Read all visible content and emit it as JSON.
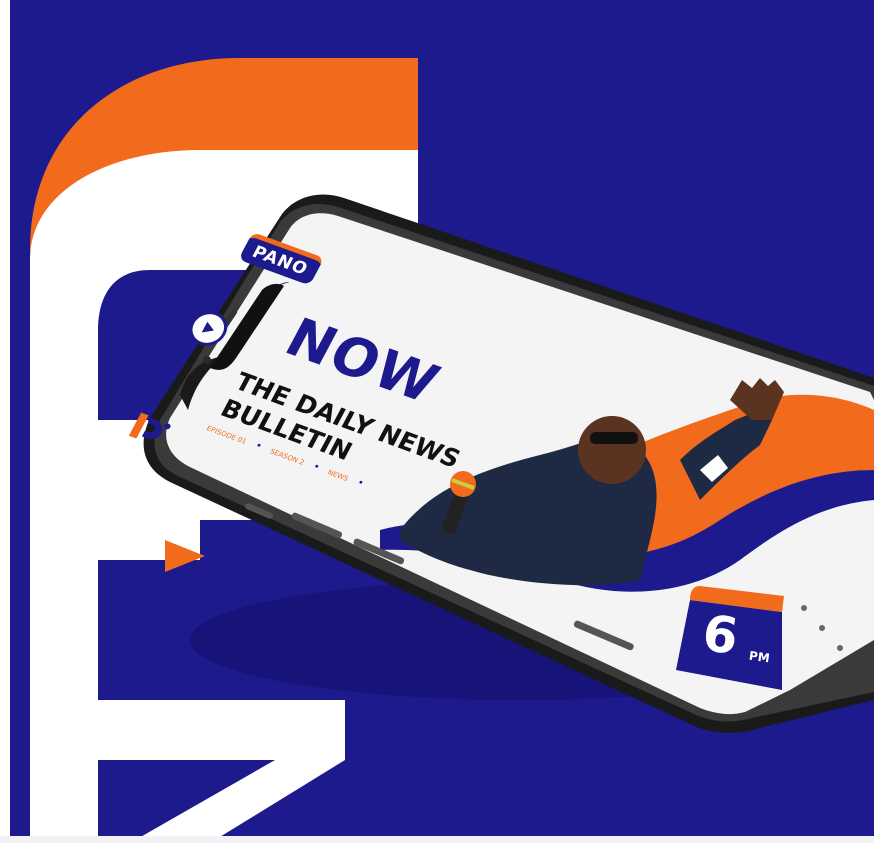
{
  "colors": {
    "background": "#1c1a8c",
    "accent": "#f26a1b",
    "screen": "#f4f4f4",
    "phone_frame": "#2b2b2b"
  },
  "screen": {
    "brand": "PANO",
    "headline": "NOW",
    "title_line1": "THE DAILY NEWS",
    "title_line2": "BULLETIN",
    "meta": {
      "episode": "EPISODE 01",
      "season": "SEASON 2",
      "category": "NEWS"
    },
    "time_badge": {
      "number": "6",
      "suffix": "PM"
    }
  },
  "icons": {
    "play": "play-icon",
    "pause": "pause-icon",
    "logo": "pano-p-logo-icon",
    "mic": "microphone-icon"
  }
}
